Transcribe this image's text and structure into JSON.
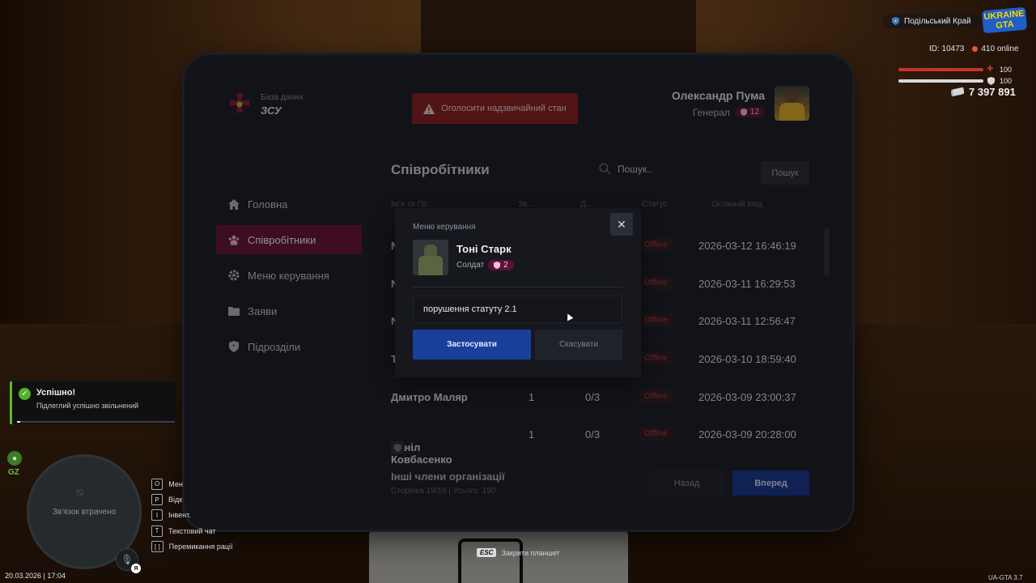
{
  "brand": {
    "subtitle": "База даних",
    "name": "ЗСУ"
  },
  "emergency_button": "Оголосити надзвичайний стан",
  "profile": {
    "name": "Олександр Пума",
    "rank": "Генерал",
    "level": "12"
  },
  "nav": [
    {
      "label": "Головна",
      "icon": "home-icon"
    },
    {
      "label": "Співробітники",
      "icon": "users-icon",
      "active": true
    },
    {
      "label": "Меню керування",
      "icon": "gear-icon"
    },
    {
      "label": "Заяви",
      "icon": "folder-icon"
    },
    {
      "label": "Підрозділи",
      "icon": "shield-icon"
    }
  ],
  "page_title": "Співробітники",
  "search": {
    "placeholder": "Пошук..",
    "button": "Пошук"
  },
  "table": {
    "headers": [
      "Ім'я та Пр...",
      "Зв...",
      "Д...",
      "Статус",
      "Останній вхід"
    ],
    "rows": [
      {
        "name": "N",
        "rank": "",
        "dep": "",
        "status": "Offline",
        "last_login": "2026-03-12 16:46:19"
      },
      {
        "name": "N",
        "rank": "",
        "dep": "",
        "status": "Offline",
        "last_login": "2026-03-11 16:29:53"
      },
      {
        "name": "N",
        "rank": "",
        "dep": "",
        "status": "Offline",
        "last_login": "2026-03-11 12:56:47"
      },
      {
        "name": "T",
        "rank": "",
        "dep": "",
        "status": "Offline",
        "last_login": "2026-03-10 18:59:40"
      },
      {
        "name": "Дмитро Маляр",
        "rank": "1",
        "dep": "0/3",
        "status": "Offline",
        "last_login": "2026-03-09 23:00:37"
      },
      {
        "name": "Даніл Ковбасенко",
        "rank": "1",
        "dep": "0/3",
        "status": "Offline",
        "last_login": "2026-03-09 20:28:00",
        "shield": true
      }
    ]
  },
  "footer": {
    "title": "Інші члени організації",
    "subtitle": "Сторінка 19/19 | Усього: 190",
    "back": "Назад",
    "next": "Вперед"
  },
  "modal": {
    "title": "Меню керування",
    "name": "Тоні Старк",
    "rank": "Солдат",
    "level": "2",
    "reason_value": "порушення статуту 2.1",
    "apply": "Застосувати",
    "cancel": "Скасувати"
  },
  "hud": {
    "region": "Подільський Край",
    "logo_line1": "UKRAINE",
    "logo_line2": "GTA",
    "id": "ID: 10473",
    "online": "410 online",
    "health": "100",
    "armor": "100",
    "money": "7 397 891"
  },
  "notification": {
    "title": "Успішно!",
    "message": "Підлеглий успішно звільнений"
  },
  "gz": "GZ",
  "minimap_text": "Зв'язок втрачено",
  "voice_key": "Я",
  "datetime": "20.03.2026 | 17:04",
  "hotkeys": [
    {
      "key": "O",
      "label": "Мен"
    },
    {
      "key": "P",
      "label": "Відк"
    },
    {
      "key": "I",
      "label": "Інвент."
    },
    {
      "key": "T",
      "label": "Текстовий чат"
    },
    {
      "key": "[ ]",
      "label": "Перемикання рації"
    }
  ],
  "esc": {
    "key": "ESC",
    "label": "Закрити планшет"
  },
  "version": "UA-GTA 3.7",
  "colors": {
    "accent": "#6b1134",
    "primary_blue": "#1a3f9b",
    "emergency": "#8f1d22",
    "offline": "#c0363c",
    "success": "#53b02b"
  }
}
